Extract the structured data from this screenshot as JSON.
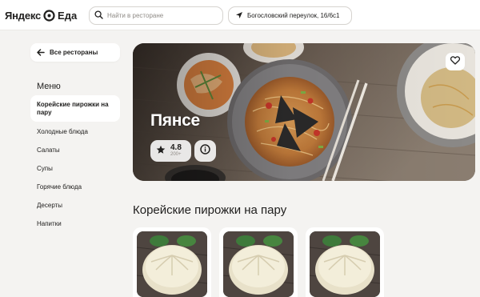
{
  "header": {
    "logo_yandex": "Яндекс",
    "logo_eda": "Еда",
    "search_placeholder": "Найти в ресторане",
    "address": "Богословский переулок, 16/6с1"
  },
  "sidebar": {
    "back_label": "Все рестораны",
    "menu_title": "Меню",
    "items": [
      {
        "label": "Корейские пирожки на пару",
        "active": true
      },
      {
        "label": "Холодные блюда"
      },
      {
        "label": "Салаты"
      },
      {
        "label": "Супы"
      },
      {
        "label": "Горячие блюда"
      },
      {
        "label": "Десерты"
      },
      {
        "label": "Напитки"
      }
    ]
  },
  "restaurant": {
    "name": "Пянсе",
    "rating": "4.8",
    "rating_count": "200+"
  },
  "section": {
    "title": "Корейские пирожки на пару"
  },
  "colors": {
    "accent": "#fce000",
    "background": "#f4f3f1",
    "text": "#21201f"
  },
  "icons": [
    "search-icon",
    "location-arrow-icon",
    "arrow-left-icon",
    "star-icon",
    "info-icon",
    "heart-icon"
  ]
}
